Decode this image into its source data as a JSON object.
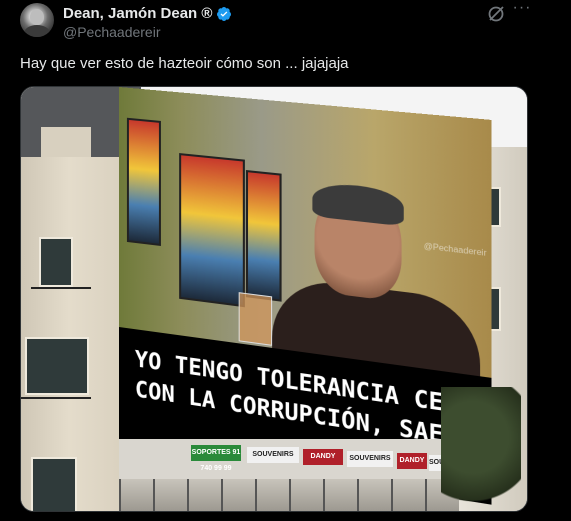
{
  "author": {
    "display_name": "Dean, Jamón Dean ®",
    "handle": "@Pechaadereir",
    "verified": true
  },
  "actions": {
    "grok_icon": "grok-icon",
    "more_label": "···"
  },
  "tweet": {
    "text": "Hay que ver esto de hazteoir cómo son ... jajajaja"
  },
  "media": {
    "billboard_lines": [
      "YO TENGO TOLERANCIA CERO",
      "CON LA CORRUPCIÓN, SAES?"
    ],
    "watermark": "@Pechaadereir",
    "store_signs": [
      "SOPORTES 91 740 99 99",
      "SOUVENIRS",
      "DANDY",
      "SOUVENIRS",
      "DANDY",
      "SOUVENIRS"
    ]
  },
  "colors": {
    "background": "#000000",
    "text_primary": "#e7e9ea",
    "text_secondary": "#71767b",
    "verified_blue": "#1d9bf0"
  }
}
